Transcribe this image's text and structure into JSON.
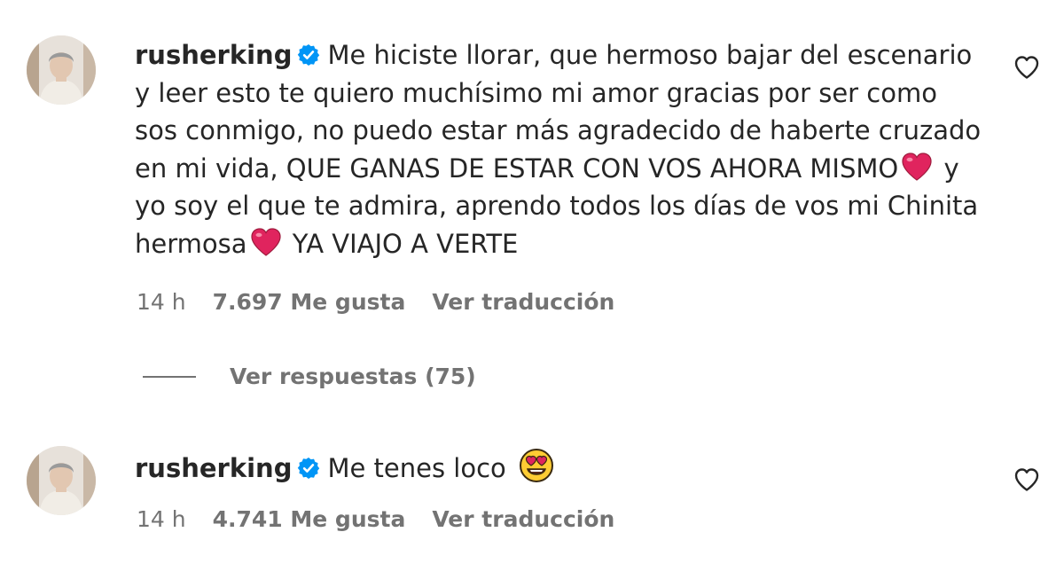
{
  "comments": [
    {
      "username": "rusherking",
      "text_part1": "Me hiciste llorar, que hermoso bajar del escenario y leer esto te quiero muchísimo mi amor gracias por ser como sos conmigo, no puedo estar más agradecido de haberte cruzado en mi vida, QUE GANAS DE ESTAR CON VOS AHORA MISMO",
      "text_part2": "y yo soy el que te admira, aprendo todos los días de vos mi Chinita hermosa",
      "text_part3": "YA VIAJO A VERTE",
      "time": "14 h",
      "likes": "7.697 Me gusta",
      "translate": "Ver traducción",
      "like_icon": "heart-outline-icon",
      "inline_emoji": "red-heart-emoji"
    },
    {
      "username": "rusherking",
      "text": "Me tenes loco",
      "time": "14 h",
      "likes": "4.741 Me gusta",
      "translate": "Ver traducción",
      "like_icon": "heart-outline-icon",
      "emoji": "heart-eyes-emoji"
    }
  ],
  "replies_label": "Ver respuestas (75)",
  "colors": {
    "text": "#262626",
    "secondary": "#737373",
    "verified": "#0095f6",
    "heart_red": "#e0245e"
  }
}
